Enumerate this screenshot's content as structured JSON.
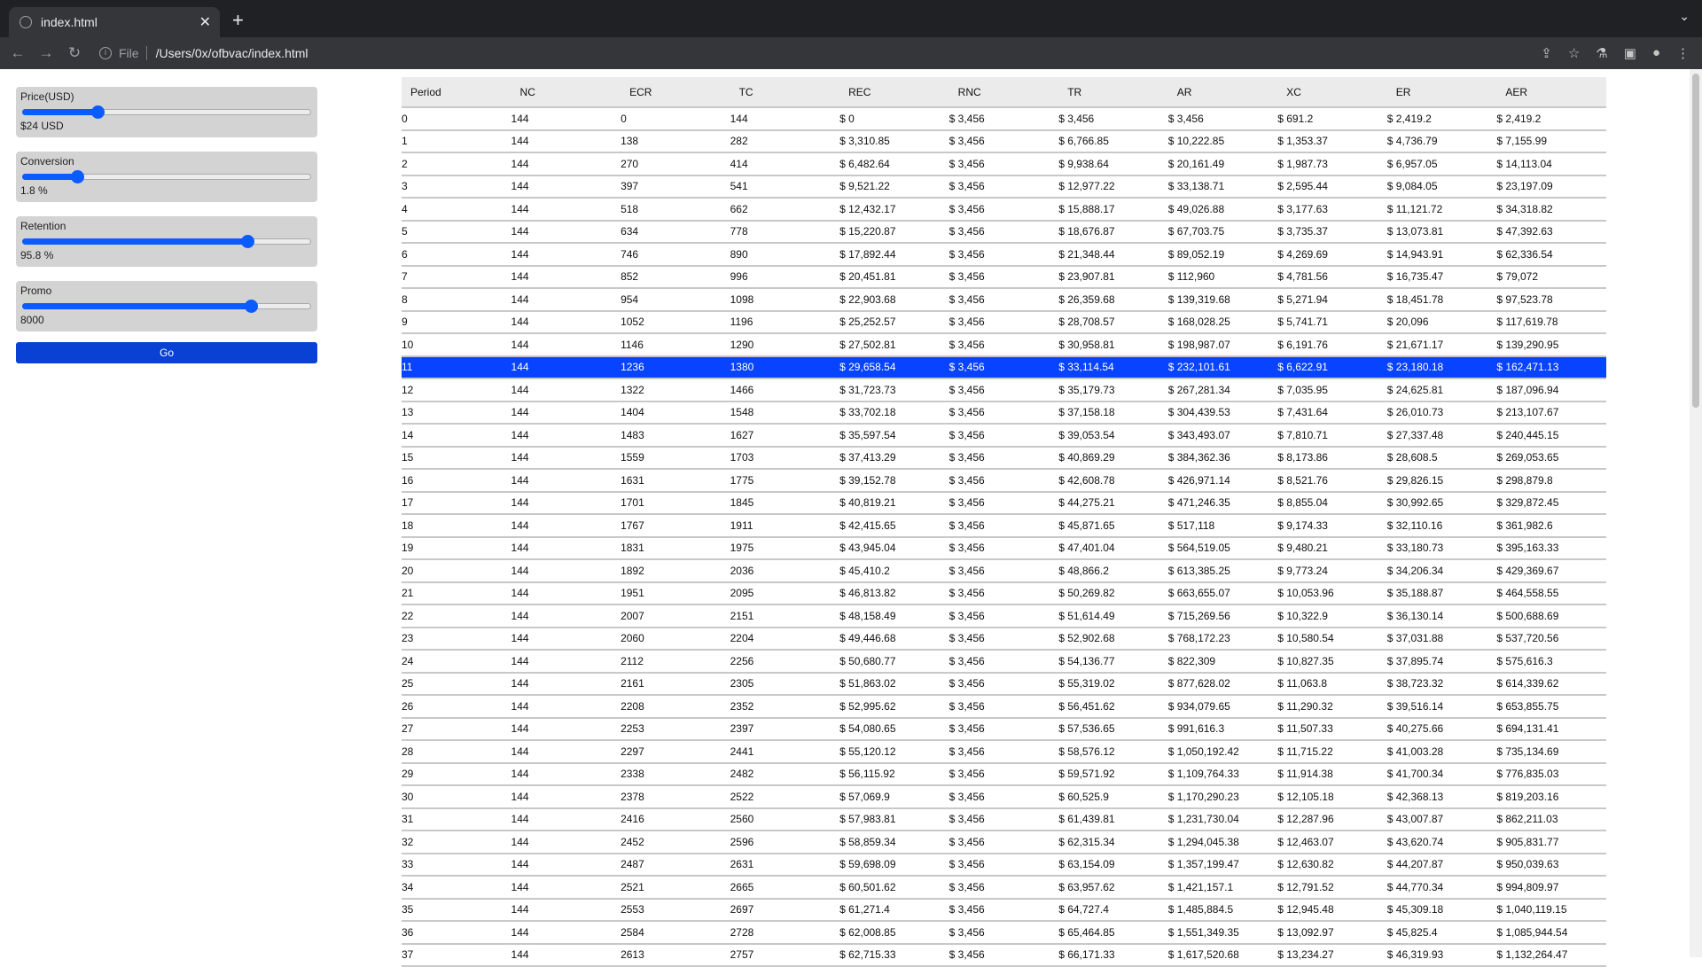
{
  "browser": {
    "tab_title": "index.html",
    "address_scheme": "File",
    "address_url": "/Users/0x/ofbvac/index.html"
  },
  "controls": [
    {
      "label": "Price(USD)",
      "value_text": "$24 USD",
      "fraction": 0.26
    },
    {
      "label": "Conversion",
      "value_text": "1.8 %",
      "fraction": 0.19
    },
    {
      "label": "Retention",
      "value_text": "95.8 %",
      "fraction": 0.78
    },
    {
      "label": "Promo",
      "value_text": "8000",
      "fraction": 0.79
    }
  ],
  "go_label": "Go",
  "accent": "#0b5cff",
  "table": {
    "headers": [
      "Period",
      "NC",
      "ECR",
      "TC",
      "REC",
      "RNC",
      "TR",
      "AR",
      "XC",
      "ER",
      "AER"
    ],
    "selected_row": 11,
    "rows": [
      [
        "0",
        "144",
        "0",
        "144",
        "$ 0",
        "$ 3,456",
        "$ 3,456",
        "$ 3,456",
        "$ 691.2",
        "$ 2,419.2",
        "$ 2,419.2"
      ],
      [
        "1",
        "144",
        "138",
        "282",
        "$ 3,310.85",
        "$ 3,456",
        "$ 6,766.85",
        "$ 10,222.85",
        "$ 1,353.37",
        "$ 4,736.79",
        "$ 7,155.99"
      ],
      [
        "2",
        "144",
        "270",
        "414",
        "$ 6,482.64",
        "$ 3,456",
        "$ 9,938.64",
        "$ 20,161.49",
        "$ 1,987.73",
        "$ 6,957.05",
        "$ 14,113.04"
      ],
      [
        "3",
        "144",
        "397",
        "541",
        "$ 9,521.22",
        "$ 3,456",
        "$ 12,977.22",
        "$ 33,138.71",
        "$ 2,595.44",
        "$ 9,084.05",
        "$ 23,197.09"
      ],
      [
        "4",
        "144",
        "518",
        "662",
        "$ 12,432.17",
        "$ 3,456",
        "$ 15,888.17",
        "$ 49,026.88",
        "$ 3,177.63",
        "$ 11,121.72",
        "$ 34,318.82"
      ],
      [
        "5",
        "144",
        "634",
        "778",
        "$ 15,220.87",
        "$ 3,456",
        "$ 18,676.87",
        "$ 67,703.75",
        "$ 3,735.37",
        "$ 13,073.81",
        "$ 47,392.63"
      ],
      [
        "6",
        "144",
        "746",
        "890",
        "$ 17,892.44",
        "$ 3,456",
        "$ 21,348.44",
        "$ 89,052.19",
        "$ 4,269.69",
        "$ 14,943.91",
        "$ 62,336.54"
      ],
      [
        "7",
        "144",
        "852",
        "996",
        "$ 20,451.81",
        "$ 3,456",
        "$ 23,907.81",
        "$ 112,960",
        "$ 4,781.56",
        "$ 16,735.47",
        "$ 79,072"
      ],
      [
        "8",
        "144",
        "954",
        "1098",
        "$ 22,903.68",
        "$ 3,456",
        "$ 26,359.68",
        "$ 139,319.68",
        "$ 5,271.94",
        "$ 18,451.78",
        "$ 97,523.78"
      ],
      [
        "9",
        "144",
        "1052",
        "1196",
        "$ 25,252.57",
        "$ 3,456",
        "$ 28,708.57",
        "$ 168,028.25",
        "$ 5,741.71",
        "$ 20,096",
        "$ 117,619.78"
      ],
      [
        "10",
        "144",
        "1146",
        "1290",
        "$ 27,502.81",
        "$ 3,456",
        "$ 30,958.81",
        "$ 198,987.07",
        "$ 6,191.76",
        "$ 21,671.17",
        "$ 139,290.95"
      ],
      [
        "11",
        "144",
        "1236",
        "1380",
        "$ 29,658.54",
        "$ 3,456",
        "$ 33,114.54",
        "$ 232,101.61",
        "$ 6,622.91",
        "$ 23,180.18",
        "$ 162,471.13"
      ],
      [
        "12",
        "144",
        "1322",
        "1466",
        "$ 31,723.73",
        "$ 3,456",
        "$ 35,179.73",
        "$ 267,281.34",
        "$ 7,035.95",
        "$ 24,625.81",
        "$ 187,096.94"
      ],
      [
        "13",
        "144",
        "1404",
        "1548",
        "$ 33,702.18",
        "$ 3,456",
        "$ 37,158.18",
        "$ 304,439.53",
        "$ 7,431.64",
        "$ 26,010.73",
        "$ 213,107.67"
      ],
      [
        "14",
        "144",
        "1483",
        "1627",
        "$ 35,597.54",
        "$ 3,456",
        "$ 39,053.54",
        "$ 343,493.07",
        "$ 7,810.71",
        "$ 27,337.48",
        "$ 240,445.15"
      ],
      [
        "15",
        "144",
        "1559",
        "1703",
        "$ 37,413.29",
        "$ 3,456",
        "$ 40,869.29",
        "$ 384,362.36",
        "$ 8,173.86",
        "$ 28,608.5",
        "$ 269,053.65"
      ],
      [
        "16",
        "144",
        "1631",
        "1775",
        "$ 39,152.78",
        "$ 3,456",
        "$ 42,608.78",
        "$ 426,971.14",
        "$ 8,521.76",
        "$ 29,826.15",
        "$ 298,879.8"
      ],
      [
        "17",
        "144",
        "1701",
        "1845",
        "$ 40,819.21",
        "$ 3,456",
        "$ 44,275.21",
        "$ 471,246.35",
        "$ 8,855.04",
        "$ 30,992.65",
        "$ 329,872.45"
      ],
      [
        "18",
        "144",
        "1767",
        "1911",
        "$ 42,415.65",
        "$ 3,456",
        "$ 45,871.65",
        "$ 517,118",
        "$ 9,174.33",
        "$ 32,110.16",
        "$ 361,982.6"
      ],
      [
        "19",
        "144",
        "1831",
        "1975",
        "$ 43,945.04",
        "$ 3,456",
        "$ 47,401.04",
        "$ 564,519.05",
        "$ 9,480.21",
        "$ 33,180.73",
        "$ 395,163.33"
      ],
      [
        "20",
        "144",
        "1892",
        "2036",
        "$ 45,410.2",
        "$ 3,456",
        "$ 48,866.2",
        "$ 613,385.25",
        "$ 9,773.24",
        "$ 34,206.34",
        "$ 429,369.67"
      ],
      [
        "21",
        "144",
        "1951",
        "2095",
        "$ 46,813.82",
        "$ 3,456",
        "$ 50,269.82",
        "$ 663,655.07",
        "$ 10,053.96",
        "$ 35,188.87",
        "$ 464,558.55"
      ],
      [
        "22",
        "144",
        "2007",
        "2151",
        "$ 48,158.49",
        "$ 3,456",
        "$ 51,614.49",
        "$ 715,269.56",
        "$ 10,322.9",
        "$ 36,130.14",
        "$ 500,688.69"
      ],
      [
        "23",
        "144",
        "2060",
        "2204",
        "$ 49,446.68",
        "$ 3,456",
        "$ 52,902.68",
        "$ 768,172.23",
        "$ 10,580.54",
        "$ 37,031.88",
        "$ 537,720.56"
      ],
      [
        "24",
        "144",
        "2112",
        "2256",
        "$ 50,680.77",
        "$ 3,456",
        "$ 54,136.77",
        "$ 822,309",
        "$ 10,827.35",
        "$ 37,895.74",
        "$ 575,616.3"
      ],
      [
        "25",
        "144",
        "2161",
        "2305",
        "$ 51,863.02",
        "$ 3,456",
        "$ 55,319.02",
        "$ 877,628.02",
        "$ 11,063.8",
        "$ 38,723.32",
        "$ 614,339.62"
      ],
      [
        "26",
        "144",
        "2208",
        "2352",
        "$ 52,995.62",
        "$ 3,456",
        "$ 56,451.62",
        "$ 934,079.65",
        "$ 11,290.32",
        "$ 39,516.14",
        "$ 653,855.75"
      ],
      [
        "27",
        "144",
        "2253",
        "2397",
        "$ 54,080.65",
        "$ 3,456",
        "$ 57,536.65",
        "$ 991,616.3",
        "$ 11,507.33",
        "$ 40,275.66",
        "$ 694,131.41"
      ],
      [
        "28",
        "144",
        "2297",
        "2441",
        "$ 55,120.12",
        "$ 3,456",
        "$ 58,576.12",
        "$ 1,050,192.42",
        "$ 11,715.22",
        "$ 41,003.28",
        "$ 735,134.69"
      ],
      [
        "29",
        "144",
        "2338",
        "2482",
        "$ 56,115.92",
        "$ 3,456",
        "$ 59,571.92",
        "$ 1,109,764.33",
        "$ 11,914.38",
        "$ 41,700.34",
        "$ 776,835.03"
      ],
      [
        "30",
        "144",
        "2378",
        "2522",
        "$ 57,069.9",
        "$ 3,456",
        "$ 60,525.9",
        "$ 1,170,290.23",
        "$ 12,105.18",
        "$ 42,368.13",
        "$ 819,203.16"
      ],
      [
        "31",
        "144",
        "2416",
        "2560",
        "$ 57,983.81",
        "$ 3,456",
        "$ 61,439.81",
        "$ 1,231,730.04",
        "$ 12,287.96",
        "$ 43,007.87",
        "$ 862,211.03"
      ],
      [
        "32",
        "144",
        "2452",
        "2596",
        "$ 58,859.34",
        "$ 3,456",
        "$ 62,315.34",
        "$ 1,294,045.38",
        "$ 12,463.07",
        "$ 43,620.74",
        "$ 905,831.77"
      ],
      [
        "33",
        "144",
        "2487",
        "2631",
        "$ 59,698.09",
        "$ 3,456",
        "$ 63,154.09",
        "$ 1,357,199.47",
        "$ 12,630.82",
        "$ 44,207.87",
        "$ 950,039.63"
      ],
      [
        "34",
        "144",
        "2521",
        "2665",
        "$ 60,501.62",
        "$ 3,456",
        "$ 63,957.62",
        "$ 1,421,157.1",
        "$ 12,791.52",
        "$ 44,770.34",
        "$ 994,809.97"
      ],
      [
        "35",
        "144",
        "2553",
        "2697",
        "$ 61,271.4",
        "$ 3,456",
        "$ 64,727.4",
        "$ 1,485,884.5",
        "$ 12,945.48",
        "$ 45,309.18",
        "$ 1,040,119.15"
      ],
      [
        "36",
        "144",
        "2584",
        "2728",
        "$ 62,008.85",
        "$ 3,456",
        "$ 65,464.85",
        "$ 1,551,349.35",
        "$ 13,092.97",
        "$ 45,825.4",
        "$ 1,085,944.54"
      ],
      [
        "37",
        "144",
        "2613",
        "2757",
        "$ 62,715.33",
        "$ 3,456",
        "$ 66,171.33",
        "$ 1,617,520.68",
        "$ 13,234.27",
        "$ 46,319.93",
        "$ 1,132,264.47"
      ]
    ]
  }
}
